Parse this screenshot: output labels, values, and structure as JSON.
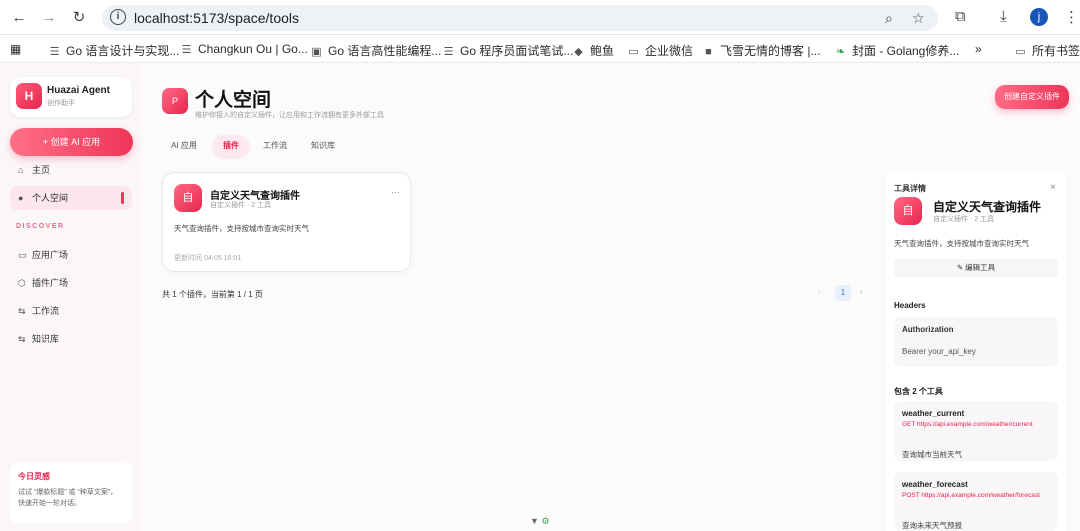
{
  "browser": {
    "url": "localhost:5173/space/tools",
    "profile_initial": "j",
    "bookmarks": [
      {
        "icon": "doc-icon",
        "label": "Go 语言设计与实现..."
      },
      {
        "icon": "doc-icon",
        "label": "Changkun Ou | Go..."
      },
      {
        "icon": "book-icon",
        "label": "Go 语言高性能编程..."
      },
      {
        "icon": "doc-icon",
        "label": "Go 程序员面试笔试..."
      },
      {
        "icon": "fish-icon",
        "label": "鲍鱼"
      },
      {
        "icon": "folder-icon",
        "label": "企业微信"
      },
      {
        "icon": "avatar-icon",
        "label": "飞雪无情的博客 |..."
      },
      {
        "icon": "leaf-icon",
        "label": "封面 - Golang修养..."
      }
    ],
    "all_bookmarks": "所有书签"
  },
  "sidebar": {
    "brand_initial": "H",
    "brand_name": "Huazai Agent",
    "brand_sub": "创作助手",
    "create_app": "+ 创建 AI 应用",
    "items": [
      {
        "icon": "home-icon",
        "label": "主页"
      },
      {
        "icon": "user-icon",
        "label": "个人空间"
      }
    ],
    "discover_label": "DISCOVER",
    "discover_items": [
      {
        "icon": "app-store-icon",
        "label": "应用广场"
      },
      {
        "icon": "plugin-store-icon",
        "label": "插件广场"
      },
      {
        "icon": "workflow-icon",
        "label": "工作流"
      },
      {
        "icon": "knowledge-icon",
        "label": "知识库"
      }
    ],
    "daily": {
      "title": "今日灵感",
      "body": "试试 “爆款标题” 或 “种草文案”，快速开始一轮对话。"
    }
  },
  "main": {
    "page_icon": "P",
    "title": "个人空间",
    "subtitle": "维护你接入的自定义插件，让应用和工作流拥有更多外部工具",
    "create_plugin": "创建自定义插件",
    "tabs": [
      "AI 应用",
      "插件",
      "工作流",
      "知识库"
    ],
    "card": {
      "icon": "自",
      "name": "自定义天气查询插件",
      "meta": "自定义插件 · 2 工具",
      "more": "···",
      "desc": "天气查询插件，支持按城市查询实时天气",
      "updated": "更新时间 04-05 16:01"
    },
    "summary": "共 1 个插件，当前第 1 / 1 页",
    "pager": {
      "prev": "‹",
      "page": "1",
      "next": "›"
    }
  },
  "detail": {
    "header": "工具详情",
    "close": "×",
    "icon": "自",
    "name": "自定义天气查询插件",
    "meta": "自定义插件 · 2 工具",
    "desc": "天气查询插件，支持按城市查询实时天气",
    "edit": "✎ 编辑工具",
    "headers_title": "Headers",
    "header_key": "Authorization",
    "header_value": "Bearer your_api_key",
    "tools_title": "包含 2 个工具",
    "tools": [
      {
        "name": "weather_current",
        "endpoint": "GET https://api.example.com/weather/current",
        "desc": "查询城市当前天气"
      },
      {
        "name": "weather_forecast",
        "endpoint": "POST https://api.example.com/weather/forecast",
        "desc": "查询未来天气预报"
      }
    ]
  }
}
